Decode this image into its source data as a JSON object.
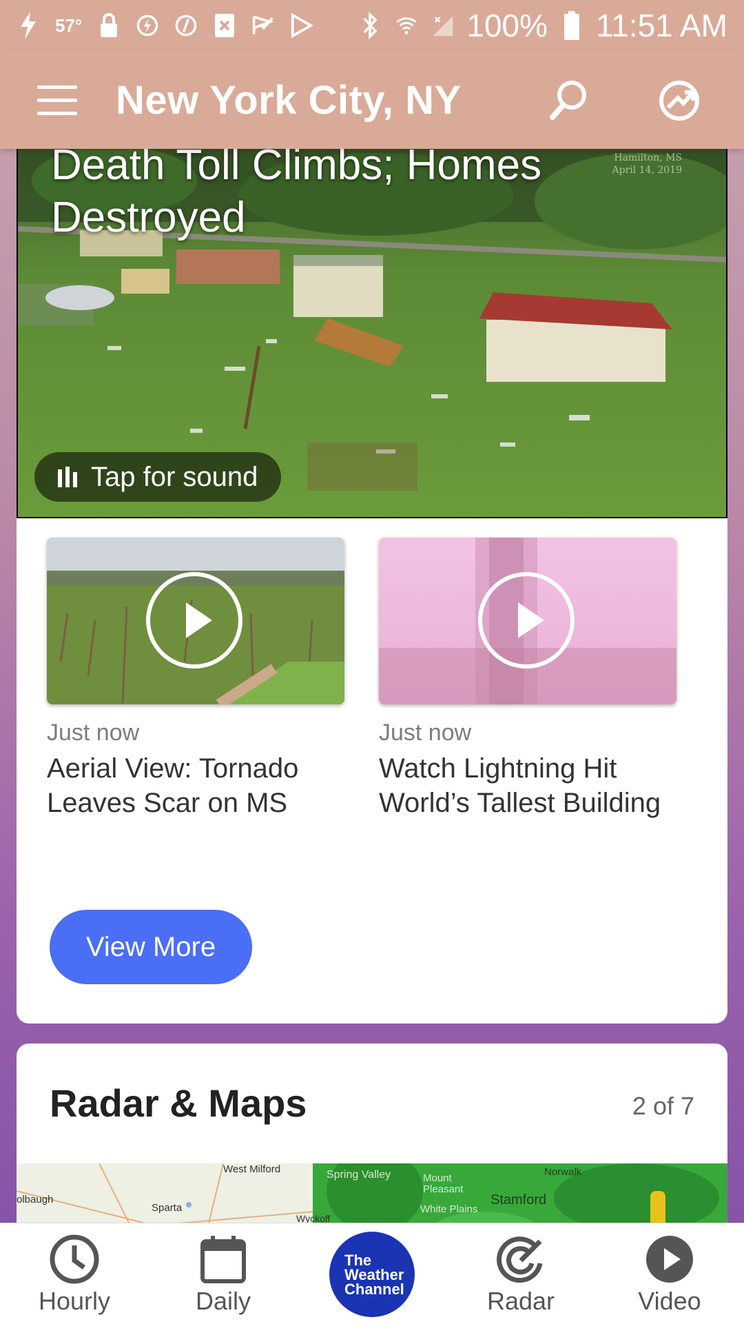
{
  "status_bar": {
    "temperature": "57°",
    "battery": "100%",
    "time": "11:51 AM",
    "left_icons": [
      "flash-icon",
      "lock-icon",
      "alarm-icon",
      "clock-icon",
      "close-box-icon",
      "check-flag-icon",
      "play-store-icon"
    ],
    "right_icons": [
      "bluetooth-icon",
      "wifi-icon",
      "signal-icon",
      "battery-icon"
    ]
  },
  "app_bar": {
    "location": "New York City, NY",
    "icons": [
      "menu-icon",
      "search-icon",
      "location-icon"
    ]
  },
  "hero": {
    "title": "Death Toll Climbs; Homes Destroyed",
    "stamp_line1": "Hamilton, MS",
    "stamp_line2": "April 14, 2019",
    "sound_label": "Tap for sound"
  },
  "videos": [
    {
      "time": "Just now",
      "headline": "Aerial View: Tornado Leaves Scar on MS"
    },
    {
      "time": "Just now",
      "headline": "Watch Lightning Hit World’s Tallest Building"
    }
  ],
  "view_more": "View More",
  "radar": {
    "title": "Radar & Maps",
    "count": "2 of 7",
    "map_labels": [
      "West Milford",
      "olbaugh",
      "Sparta",
      "Wyckoff",
      "Spring Valley",
      "Mount Pleasant",
      "White Plains",
      "Norwalk",
      "Stamford"
    ]
  },
  "bottom_nav": {
    "items": [
      "Hourly",
      "Daily",
      "Radar",
      "Video"
    ],
    "logo_lines": [
      "The",
      "Weather",
      "Channel"
    ]
  },
  "colors": {
    "app_bar": "#d9aa98",
    "button": "#4a6ef5",
    "logo": "#1a34b3"
  }
}
